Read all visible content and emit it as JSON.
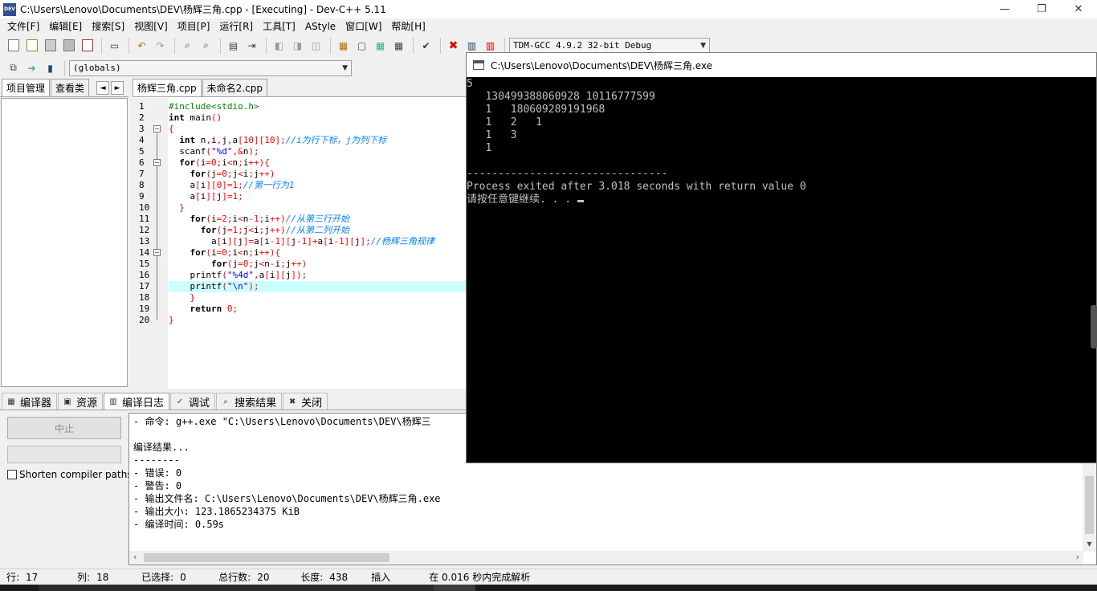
{
  "window": {
    "title": "C:\\Users\\Lenovo\\Documents\\DEV\\杨辉三角.cpp - [Executing] - Dev-C++ 5.11",
    "logo": "DEV",
    "controls": {
      "minimize": "—",
      "restore": "❐",
      "close": "✕"
    }
  },
  "menu": [
    "文件[F]",
    "编辑[E]",
    "搜索[S]",
    "视图[V]",
    "项目[P]",
    "运行[R]",
    "工具[T]",
    "AStyle",
    "窗口[W]",
    "帮助[H]"
  ],
  "toolbar": {
    "compiler_select": "TDM-GCC 4.9.2 32-bit Debug",
    "scope_select": "(globals)",
    "icons": [
      "new-file-icon",
      "open-icon",
      "save-icon",
      "save-all-icon",
      "close-file-icon",
      "print-icon",
      "undo-icon",
      "redo-icon",
      "find-icon",
      "replace-icon",
      "goto-icon",
      "indent-icon",
      "bookmark-icon",
      "bookmark-next-icon",
      "compile-icon",
      "run-icon",
      "compile-run-icon",
      "rebuild-icon",
      "check-syntax-icon",
      "stop-icon",
      "chart-icon",
      "profile-icon"
    ]
  },
  "left_panel": {
    "tabs": [
      "项目管理",
      "查看类"
    ],
    "nav_prev": "◄",
    "nav_next": "►"
  },
  "editor": {
    "tabs": [
      "杨辉三角.cpp",
      "未命名2.cpp"
    ],
    "highlight_line": 17,
    "folds": [
      3,
      6,
      14
    ],
    "lines": [
      {
        "n": "1",
        "text": "#include<stdio.h>"
      },
      {
        "n": "2",
        "text": "int main()"
      },
      {
        "n": "3",
        "text": "{"
      },
      {
        "n": "4",
        "text": "  int n,i,j,a[10][10];//i为行下标，j为列下标"
      },
      {
        "n": "5",
        "text": "  scanf(\"%d\",&n);"
      },
      {
        "n": "6",
        "text": "  for(i=0;i<n;i++){"
      },
      {
        "n": "7",
        "text": "    for(j=0;j<i;j++)"
      },
      {
        "n": "8",
        "text": "    a[i][0]=1;//第一行为1"
      },
      {
        "n": "9",
        "text": "    a[i][j]=1;"
      },
      {
        "n": "10",
        "text": "  }"
      },
      {
        "n": "11",
        "text": "    for(i=2;i<n-1;i++)//从第三行开始"
      },
      {
        "n": "12",
        "text": "      for(j=1;j<i;j++)//从第二列开始"
      },
      {
        "n": "13",
        "text": "        a[i][j]=a[i-1][j-1]+a[i-1][j];//杨辉三角规律"
      },
      {
        "n": "14",
        "text": "    for(i=0;i<n;i++){"
      },
      {
        "n": "15",
        "text": "        for(j=0;j<n-i;j++)"
      },
      {
        "n": "16",
        "text": "    printf(\"%4d\",a[i][j]);"
      },
      {
        "n": "17",
        "text": "    printf(\"\\n\");"
      },
      {
        "n": "18",
        "text": "    }"
      },
      {
        "n": "19",
        "text": "    return 0;"
      },
      {
        "n": "20",
        "text": "}"
      }
    ]
  },
  "bottom_panel": {
    "tabs": [
      {
        "label": "编译器",
        "icon": "compiler-icon",
        "glyph": "▦"
      },
      {
        "label": "资源",
        "icon": "resources-icon",
        "glyph": "▣"
      },
      {
        "label": "编译日志",
        "icon": "compile-log-icon",
        "glyph": "▥"
      },
      {
        "label": "调试",
        "icon": "debug-icon",
        "glyph": "✓"
      },
      {
        "label": "搜索结果",
        "icon": "search-results-icon",
        "glyph": "⌕"
      },
      {
        "label": "关闭",
        "icon": "close-panel-icon",
        "glyph": "✖"
      }
    ],
    "active_tab": 2,
    "abort_button": "中止",
    "shorten_paths_label": "Shorten compiler paths",
    "shorten_paths_checked": false,
    "log_lines": [
      "- 命令: g++.exe \"C:\\Users\\Lenovo\\Documents\\DEV\\杨辉三",
      "",
      "编译结果...",
      "--------",
      "- 错误: 0",
      "- 警告: 0",
      "- 输出文件名: C:\\Users\\Lenovo\\Documents\\DEV\\杨辉三角.exe",
      "- 输出大小: 123.1865234375 KiB",
      "- 编译时间: 0.59s"
    ]
  },
  "status_bar": {
    "row_label": "行:",
    "row": "17",
    "col_label": "列:",
    "col": "18",
    "sel_label": "已选择:",
    "sel": "0",
    "lines_label": "总行数:",
    "lines": "20",
    "len_label": "长度:",
    "len": "438",
    "mode": "插入",
    "parse": "在 0.016 秒内完成解析"
  },
  "console": {
    "title": "C:\\Users\\Lenovo\\Documents\\DEV\\杨辉三角.exe",
    "lines": [
      "5",
      "   130499388060928 10116777599",
      "   1   180609289191968",
      "   1   2   1",
      "   1   3",
      "   1",
      "",
      "--------------------------------",
      "Process exited after 3.018 seconds with return value 0",
      "请按任意键继续. . . "
    ]
  },
  "colors": {
    "current_line": "#ccffff",
    "preprocessor": "#008000",
    "string": "#0000ff",
    "number": "#ff0000",
    "comment": "#0080ff",
    "console_bg": "#000000",
    "console_fg": "#c0c0c0"
  }
}
